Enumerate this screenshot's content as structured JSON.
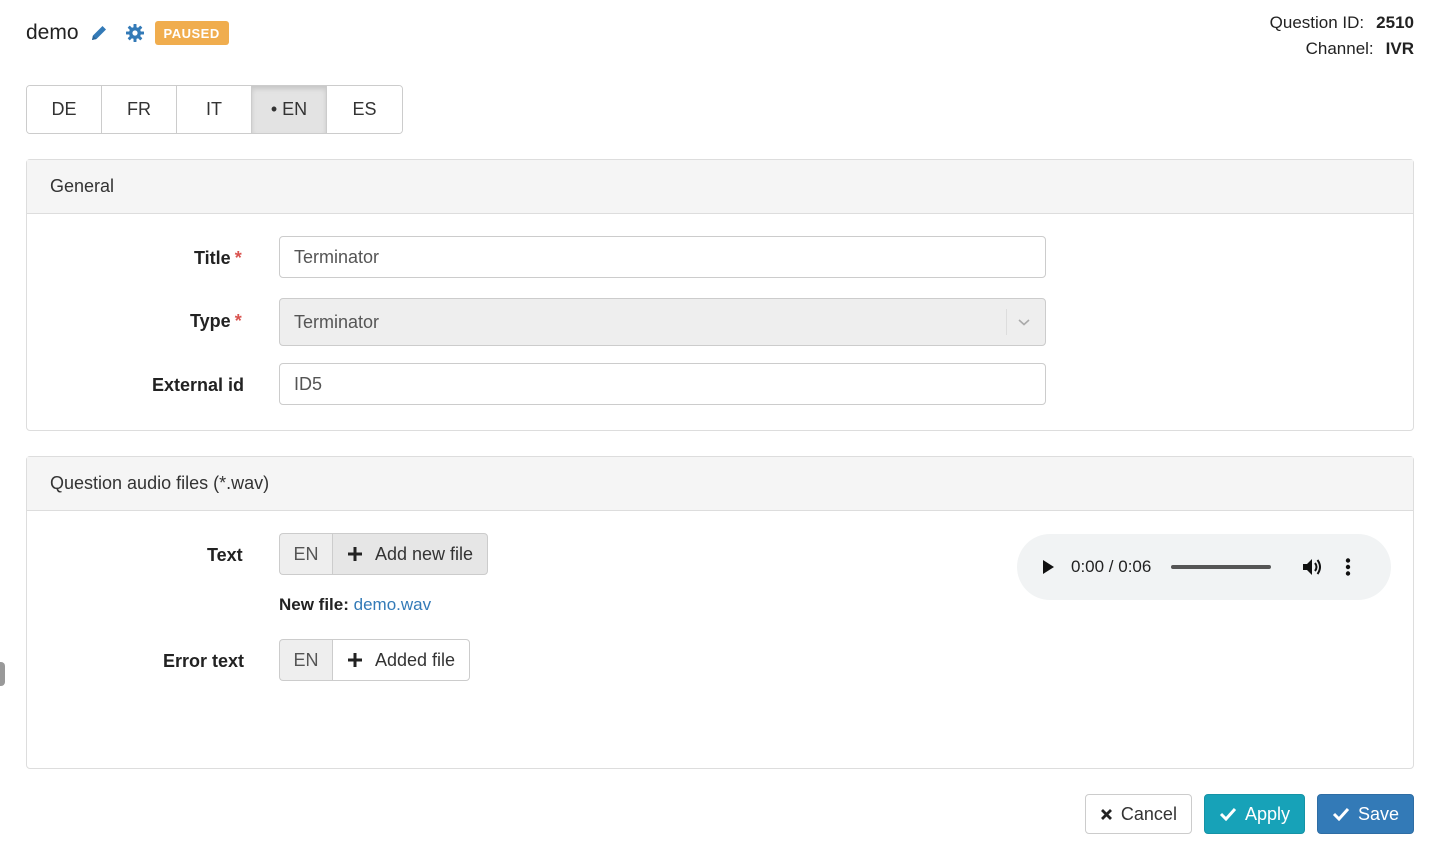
{
  "header": {
    "name": "demo",
    "status": "PAUSED",
    "question_id_label": "Question ID:",
    "question_id": "2510",
    "channel_label": "Channel:",
    "channel": "IVR"
  },
  "languages": [
    {
      "label": "DE",
      "active": false
    },
    {
      "label": "FR",
      "active": false
    },
    {
      "label": "IT",
      "active": false
    },
    {
      "label": "• EN",
      "active": true
    },
    {
      "label": "ES",
      "active": false
    }
  ],
  "general": {
    "heading": "General",
    "title_label": "Title",
    "title_value": "Terminator",
    "type_label": "Type",
    "type_value": "Terminator",
    "external_label": "External id",
    "external_value": "ID5",
    "required_mark": "*"
  },
  "audio": {
    "heading": "Question audio files (*.wav)",
    "text_label": "Text",
    "text_lang": "EN",
    "add_new_label": "Add new file",
    "new_file_label": "New file:",
    "new_file_name": "demo.wav",
    "error_label": "Error text",
    "error_lang": "EN",
    "added_label": "Added file",
    "player_time": "0:00 / 0:06"
  },
  "actions": {
    "cancel": "Cancel",
    "apply": "Apply",
    "save": "Save"
  },
  "colors": {
    "badge": "#f0ad4e",
    "link": "#337ab7",
    "apply": "#17a2b8",
    "save": "#337ab7",
    "required": "#d9534f"
  }
}
